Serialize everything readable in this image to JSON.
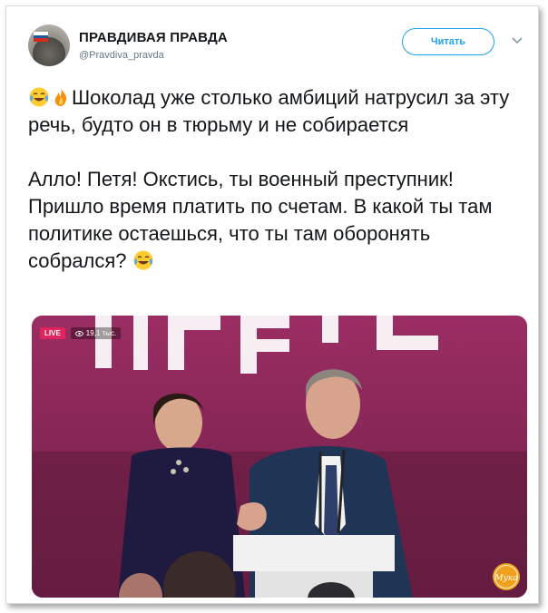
{
  "account": {
    "display_name": "ПРАВДИВАЯ ПРАВДА",
    "handle": "@Pravdiva_pravda"
  },
  "header": {
    "follow_label": "Читать",
    "more_icon": "chevron-down-icon"
  },
  "tweet": {
    "paragraph1": "Шоколад уже столько амбиций натрусил за эту речь, будто он в тюрьму и не собирается",
    "paragraph2": "Алло! Петя! Окстись, ты военный преступник! Пришло время платить по счетам. В какой ты там политике остаешься, что ты там оборонять собрался?",
    "emojis": [
      "tears-of-joy-emoji",
      "fire-emoji",
      "tears-of-joy-emoji"
    ]
  },
  "media": {
    "live_label": "LIVE",
    "views": "19,1 тыс.",
    "watermark": "Мука"
  },
  "colors": {
    "accent": "#1da1f2",
    "live": "#e0245e",
    "stage": "#8a2a58"
  }
}
